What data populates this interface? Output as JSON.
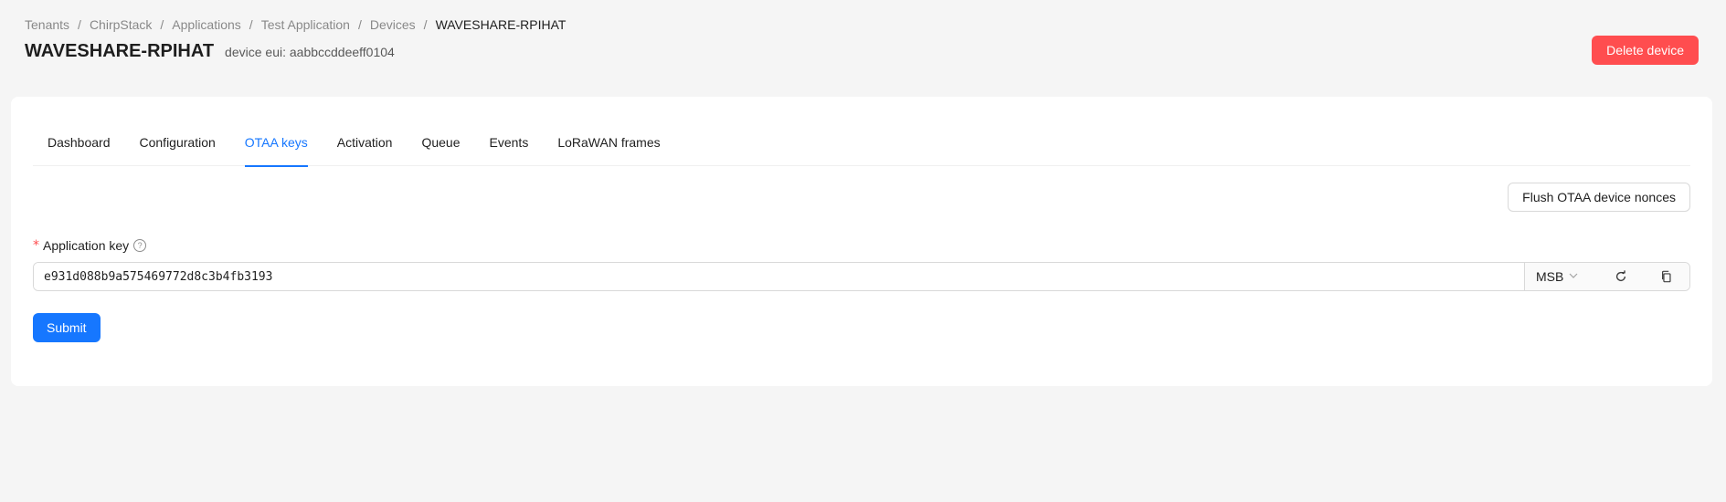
{
  "breadcrumb": [
    "Tenants",
    "ChirpStack",
    "Applications",
    "Test Application",
    "Devices"
  ],
  "breadcrumb_current": "WAVESHARE-RPIHAT",
  "breadcrumb_sep": "/",
  "header": {
    "title": "WAVESHARE-RPIHAT",
    "subtitle": "device eui: aabbccddeeff0104",
    "delete_label": "Delete device"
  },
  "tabs": [
    "Dashboard",
    "Configuration",
    "OTAA keys",
    "Activation",
    "Queue",
    "Events",
    "LoRaWAN frames"
  ],
  "active_tab": "OTAA keys",
  "flush_label": "Flush OTAA device nonces",
  "form": {
    "required_mark": "*",
    "label": "Application key",
    "help_glyph": "?",
    "value": "e931d088b9a575469772d8c3b4fb3193",
    "byte_order": "MSB",
    "submit_label": "Submit"
  },
  "colors": {
    "primary": "#1677ff",
    "danger": "#ff4d4f",
    "background": "#f5f5f5"
  },
  "icons": {
    "regenerate": "refresh-icon",
    "copy": "copy-icon",
    "help": "question-circle-icon",
    "dropdown": "chevron-down-icon"
  }
}
